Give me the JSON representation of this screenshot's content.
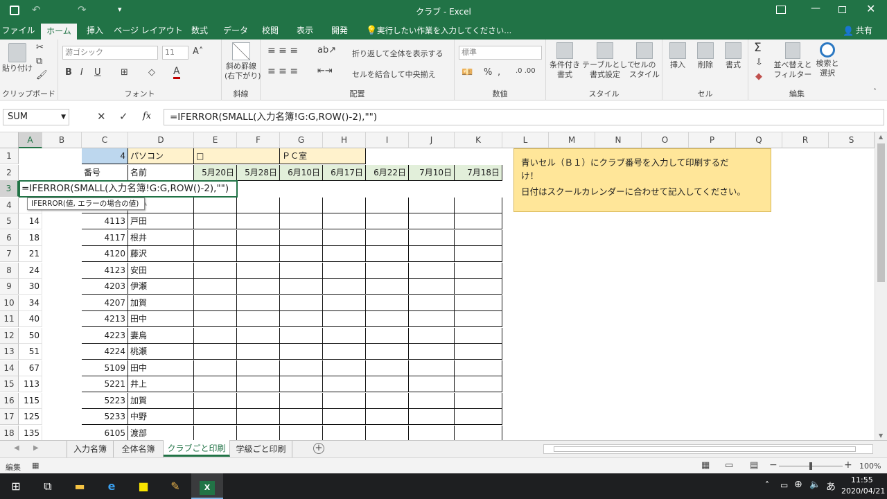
{
  "window": {
    "title": "クラブ - Excel"
  },
  "tabs": [
    "ファイル",
    "ホーム",
    "挿入",
    "ページ レイアウト",
    "数式",
    "データ",
    "校閲",
    "表示",
    "開発"
  ],
  "tell_me": "実行したい作業を入力してください...",
  "share": "共有",
  "ribbon": {
    "clipboard": {
      "label": "クリップボード",
      "paste": "貼り付け"
    },
    "font": {
      "label": "フォント",
      "name": "游ゴシック",
      "size": "11",
      "bold": "B",
      "italic": "I",
      "underline": "U"
    },
    "diag": {
      "label": "斜線",
      "button": "斜め罫線\n(右下がり)"
    },
    "align": {
      "label": "配置",
      "wrap": "折り返して全体を表示する",
      "merge": "セルを結合して中央揃え"
    },
    "number": {
      "label": "数値",
      "format": "標準",
      "percent": "%"
    },
    "styles": {
      "label": "スタイル",
      "cond": "条件付き\n書式",
      "table": "テーブルとして\n書式設定",
      "cell": "セルの\nスタイル"
    },
    "cells": {
      "label": "セル",
      "insert": "挿入",
      "delete": "削除",
      "format": "書式"
    },
    "editing": {
      "label": "編集",
      "sort": "並べ替えと\nフィルター",
      "find": "検索と\n選択"
    }
  },
  "formula_bar": {
    "name_box": "SUM",
    "formula": "=IFERROR(SMALL(入力名簿!G:G,ROW()-2),\"\")",
    "fx": "fx"
  },
  "columns": [
    "A",
    "B",
    "C",
    "D",
    "E",
    "F",
    "G",
    "H",
    "I",
    "J",
    "K",
    "L",
    "M",
    "N",
    "O",
    "P",
    "Q",
    "R",
    "S"
  ],
  "row_numbers": [
    "1",
    "2",
    "3",
    "4",
    "5",
    "6",
    "7",
    "8",
    "9",
    "10",
    "11",
    "12",
    "13",
    "14",
    "15",
    "16",
    "17",
    "18"
  ],
  "sheet": {
    "c1": "4",
    "d1": "パソコン",
    "e1": "□",
    "g1": "ＰＣ室",
    "c2": "番号",
    "d2": "名前",
    "dates": [
      "5月20日",
      "5月28日",
      "6月10日",
      "6月17日",
      "6月22日",
      "7月10日",
      "7月18日"
    ],
    "edit_text": "=IFERROR(SMALL(入力名簿!G:G,ROW()-2),\"\")",
    "tooltip": "IFERROR(値, エラーの場合の値)",
    "d4_partial": "まか",
    "rows": [
      {
        "a": "14",
        "c": "4113",
        "d": "戸田"
      },
      {
        "a": "18",
        "c": "4117",
        "d": "根井"
      },
      {
        "a": "21",
        "c": "4120",
        "d": "藤沢"
      },
      {
        "a": "24",
        "c": "4123",
        "d": "安田"
      },
      {
        "a": "30",
        "c": "4203",
        "d": "伊瀬"
      },
      {
        "a": "34",
        "c": "4207",
        "d": "加賀"
      },
      {
        "a": "40",
        "c": "4213",
        "d": "田中"
      },
      {
        "a": "50",
        "c": "4223",
        "d": "妻鳥"
      },
      {
        "a": "51",
        "c": "4224",
        "d": "桃瀬"
      },
      {
        "a": "67",
        "c": "5109",
        "d": "田中"
      },
      {
        "a": "113",
        "c": "5221",
        "d": "井上"
      },
      {
        "a": "115",
        "c": "5223",
        "d": "加賀"
      },
      {
        "a": "125",
        "c": "5233",
        "d": "中野"
      },
      {
        "a": "135",
        "c": "6105",
        "d": "渡部"
      }
    ],
    "note_line1": "青いセル（Ｂ１）にクラブ番号を入力して印刷するだ",
    "note_line2": "け！",
    "note_line3": "日付はスクールカレンダーに合わせて記入してください。"
  },
  "sheet_tabs": [
    "入力名簿",
    "全体名簿",
    "クラブごと印刷",
    "学級ごと印刷"
  ],
  "status": {
    "mode": "編集",
    "zoom": "100%"
  },
  "taskbar": {
    "time": "11:55",
    "date": "2020/04/21",
    "ime": "あ"
  },
  "colors": {
    "excel_green": "#217346",
    "blue_cell": "#bdd7ee",
    "yellow_cell": "#fff2cc",
    "green_cell": "#e2efda",
    "note": "#ffe699"
  }
}
